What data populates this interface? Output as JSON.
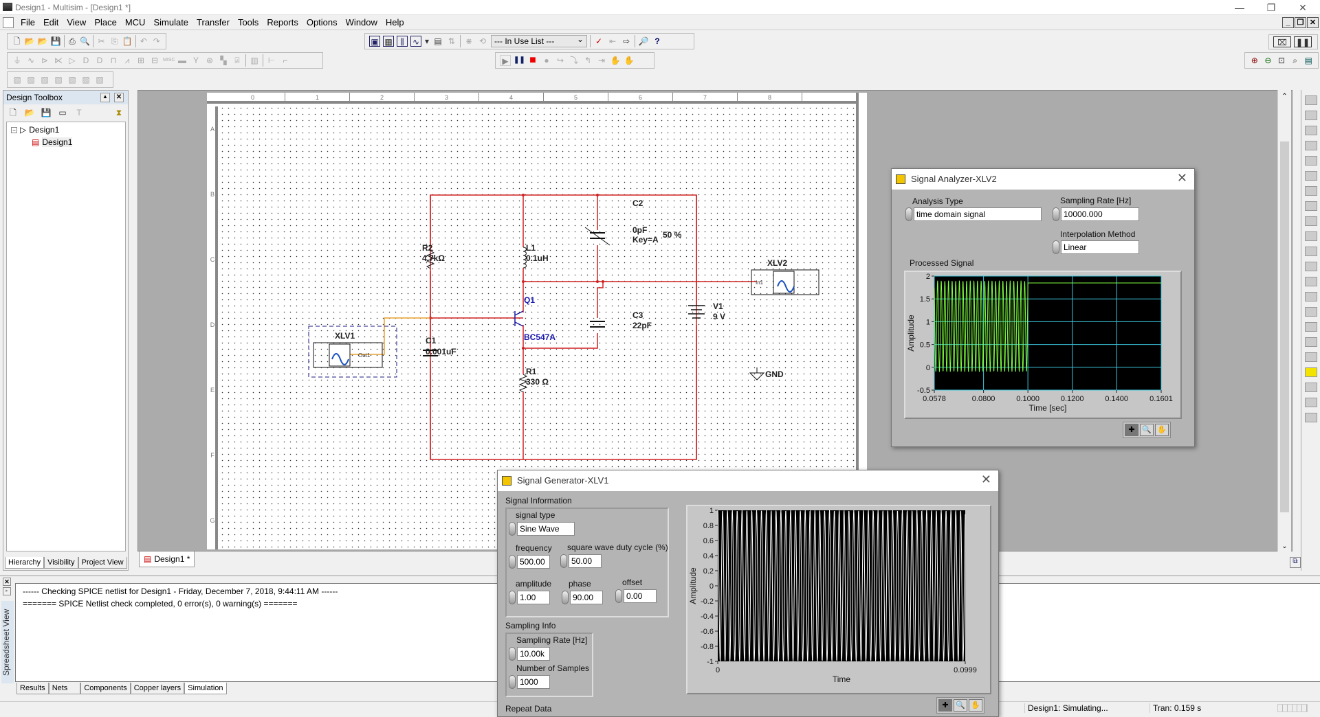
{
  "window": {
    "title": "Design1 - Multisim - [Design1 *]",
    "controls": {
      "minimize": "—",
      "restore": "❐",
      "close": "✕"
    }
  },
  "menu": [
    "File",
    "Edit",
    "View",
    "Place",
    "MCU",
    "Simulate",
    "Transfer",
    "Tools",
    "Reports",
    "Options",
    "Window",
    "Help"
  ],
  "mdi_controls": {
    "minimize": "_",
    "restore": "❐",
    "close": "✕"
  },
  "toolbar": {
    "standard": [
      "new-icon",
      "open-icon",
      "open-sample-icon",
      "save-icon",
      "print-icon",
      "print-preview-icon",
      "cut-icon",
      "copy-icon",
      "paste-icon",
      "undo-icon",
      "redo-icon"
    ],
    "view": [
      "toggle-toolbox-icon",
      "spreadsheet-icon",
      "grapher-icon",
      "postprocessor-icon",
      "database-icon",
      "component-icon"
    ],
    "in_use_list": "--- In Use List ---",
    "simulation": {
      "run": "▶",
      "pause": "❚❚",
      "stop": "■"
    },
    "help": "?"
  },
  "toolbox": {
    "title": "Design Toolbox",
    "tree": [
      {
        "label": "Design1",
        "level": 0
      },
      {
        "label": "Design1",
        "level": 1
      }
    ],
    "tabs": [
      "Hierarchy",
      "Visibility",
      "Project View"
    ],
    "active_tab": "Hierarchy"
  },
  "ruler": {
    "columns": [
      "0",
      "1",
      "2",
      "3",
      "4",
      "5",
      "6",
      "7",
      "8",
      ""
    ],
    "rows": [
      "A",
      "B",
      "C",
      "D",
      "E",
      "F",
      "G"
    ]
  },
  "schematic": {
    "components": [
      {
        "ref": "R2",
        "value": "4.7kΩ"
      },
      {
        "ref": "L1",
        "value": "0.1uH"
      },
      {
        "ref": "C2",
        "value": "0pF",
        "extra": "Key=A",
        "percent": "50 %"
      },
      {
        "ref": "Q1",
        "value": "BC547A"
      },
      {
        "ref": "C1",
        "value": "0.001uF"
      },
      {
        "ref": "C3",
        "value": "22pF"
      },
      {
        "ref": "R1",
        "value": "330 Ω"
      },
      {
        "ref": "V1",
        "value": "9 V"
      },
      {
        "ref": "GND",
        "value": ""
      }
    ],
    "instruments": [
      {
        "ref": "XLV1",
        "port": "Out1"
      },
      {
        "ref": "XLV2",
        "port": "In1"
      }
    ]
  },
  "doc_tab": "Design1 *",
  "spreadsheet": {
    "title": "Spreadsheet View",
    "lines": [
      "------ Checking SPICE netlist for Design1 - Friday, December 7, 2018, 9:44:11 AM ------",
      "======= SPICE Netlist check completed, 0 error(s), 0 warning(s) ======="
    ],
    "tabs": [
      "Results",
      "Nets",
      "Components",
      "Copper layers",
      "Simulation"
    ],
    "active_tab": "Simulation"
  },
  "status": {
    "simulating": "Design1: Simulating...",
    "tran": "Tran: 0.159 s"
  },
  "analyzer": {
    "title": "Signal Analyzer-XLV2",
    "analysis_type_label": "Analysis Type",
    "analysis_type": "time domain signal",
    "sampling_rate_label": "Sampling Rate [Hz]",
    "sampling_rate": "10000.000",
    "interpolation_label": "Interpolation Method",
    "interpolation": "Linear",
    "plot_label": "Processed Signal"
  },
  "generator": {
    "title": "Signal Generator-XLV1",
    "signal_info_label": "Signal Information",
    "signal_type_label": "signal type",
    "signal_type": "Sine Wave",
    "frequency_label": "frequency",
    "frequency": "500.00",
    "duty_label": "square wave duty cycle (%)",
    "duty": "50.00",
    "amplitude_label": "amplitude",
    "amplitude": "1.00",
    "phase_label": "phase",
    "phase": "90.00",
    "offset_label": "offset",
    "offset": "0.00",
    "sampling_info_label": "Sampling Info",
    "sampling_rate_label": "Sampling Rate [Hz]",
    "sampling_rate": "10.00k",
    "samples_label": "Number of Samples",
    "samples": "1000",
    "repeat_label": "Repeat Data"
  },
  "chart_data": [
    {
      "type": "line",
      "title": "Processed Signal",
      "xlabel": "Time [sec]",
      "ylabel": "Amplitude",
      "xlim": [
        0.0578,
        0.1601
      ],
      "ylim": [
        -0.5,
        2
      ],
      "x_ticks": [
        "0.0578",
        "0.0800",
        "0.1000",
        "0.1200",
        "0.1400",
        "0.1601"
      ],
      "y_ticks": [
        "2",
        "1.5",
        "1",
        "0.5",
        "0",
        "-0.5"
      ],
      "grid": true,
      "series": [
        {
          "name": "signal",
          "color": "#7fff3f",
          "description": "sine oscillating between ~-0.1 and ~1.9 from 0.0578 to 0.1000 s, then flat at ~1.85",
          "freq_hz": 500,
          "min": -0.1,
          "max": 1.9,
          "x_end_osc": 0.1,
          "hold_value": 1.85
        }
      ]
    },
    {
      "type": "line",
      "title": "",
      "xlabel": "Time",
      "ylabel": "Amplitude",
      "xlim": [
        0,
        0.0999
      ],
      "ylim": [
        -1,
        1
      ],
      "x_ticks": [
        "0",
        "0.0999"
      ],
      "y_ticks": [
        "1",
        "0.8",
        "0.6",
        "0.4",
        "0.2",
        "0",
        "-0.2",
        "-0.4",
        "-0.6",
        "-0.8",
        "-1"
      ],
      "grid": false,
      "series": [
        {
          "name": "generated",
          "color": "#ffffff",
          "description": "sine wave, amplitude 1, 500 Hz, phase 90°, 10 kHz sampling, 1000 samples",
          "amplitude": 1,
          "freq_hz": 500,
          "phase_deg": 90,
          "sample_rate": 10000,
          "samples": 1000
        }
      ]
    }
  ]
}
